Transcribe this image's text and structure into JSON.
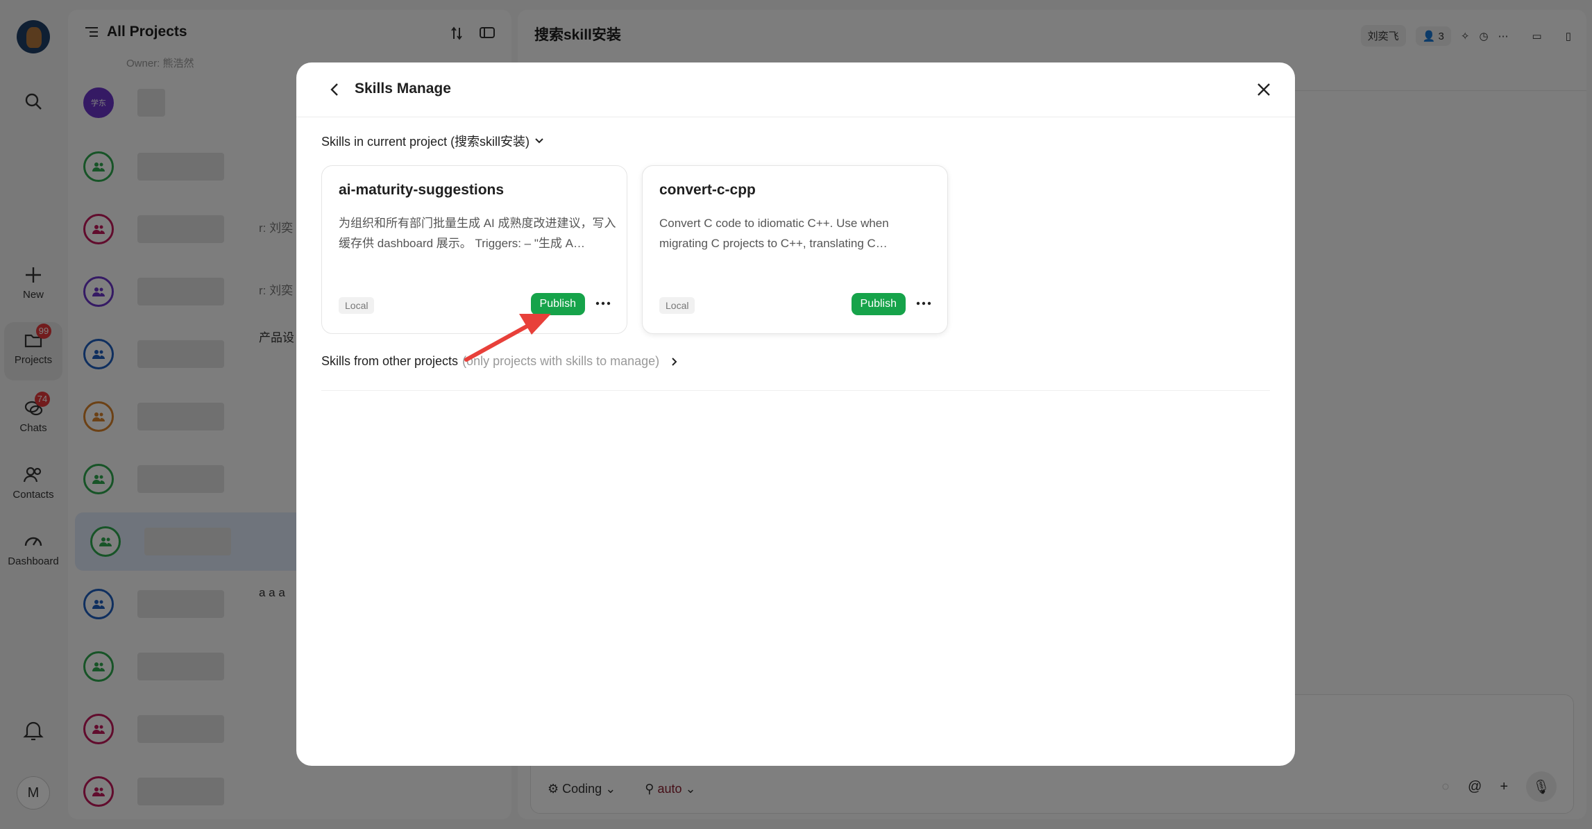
{
  "window": {
    "title": "搜索skill安装"
  },
  "rail": {
    "items": [
      {
        "label": "New",
        "icon": "plus-icon"
      },
      {
        "label": "Projects",
        "icon": "folder-icon",
        "badge": "99"
      },
      {
        "label": "Chats",
        "icon": "chat-bubbles-icon",
        "badge": "74"
      },
      {
        "label": "Contacts",
        "icon": "contacts-icon"
      },
      {
        "label": "Dashboard",
        "icon": "gauge-icon"
      }
    ],
    "me_initial": "M"
  },
  "project_list": {
    "title": "All Projects",
    "owner_line": "Owner: 熊浩然",
    "first_avatar_text": "学东",
    "snippets": [
      "r: 刘奕",
      "r: 刘奕",
      "产品设",
      "a a a"
    ]
  },
  "chat": {
    "title": "搜索skill安装",
    "user_pill": "刘奕飞",
    "members_pill": "3",
    "composer": {
      "mode": "Coding",
      "model": "auto"
    }
  },
  "modal": {
    "title": "Skills Manage",
    "current_section": "Skills in current project (搜索skill安装)",
    "cards": [
      {
        "name": "ai-maturity-suggestions",
        "desc": "为组织和所有部门批量生成 AI 成熟度改进建议，写入缓存供 dashboard 展示。 Triggers: – \"生成 A…",
        "tag": "Local",
        "action": "Publish"
      },
      {
        "name": "convert-c-cpp",
        "desc": "Convert C code to idiomatic C++. Use when migrating C projects to C++, translating C…",
        "tag": "Local",
        "action": "Publish"
      }
    ],
    "other_section": "Skills from other projects",
    "other_hint": "(only projects with skills to manage)"
  },
  "colors": {
    "publish": "#16a34a",
    "badge": "#e5393b",
    "annotation_arrow": "#e8403a"
  }
}
